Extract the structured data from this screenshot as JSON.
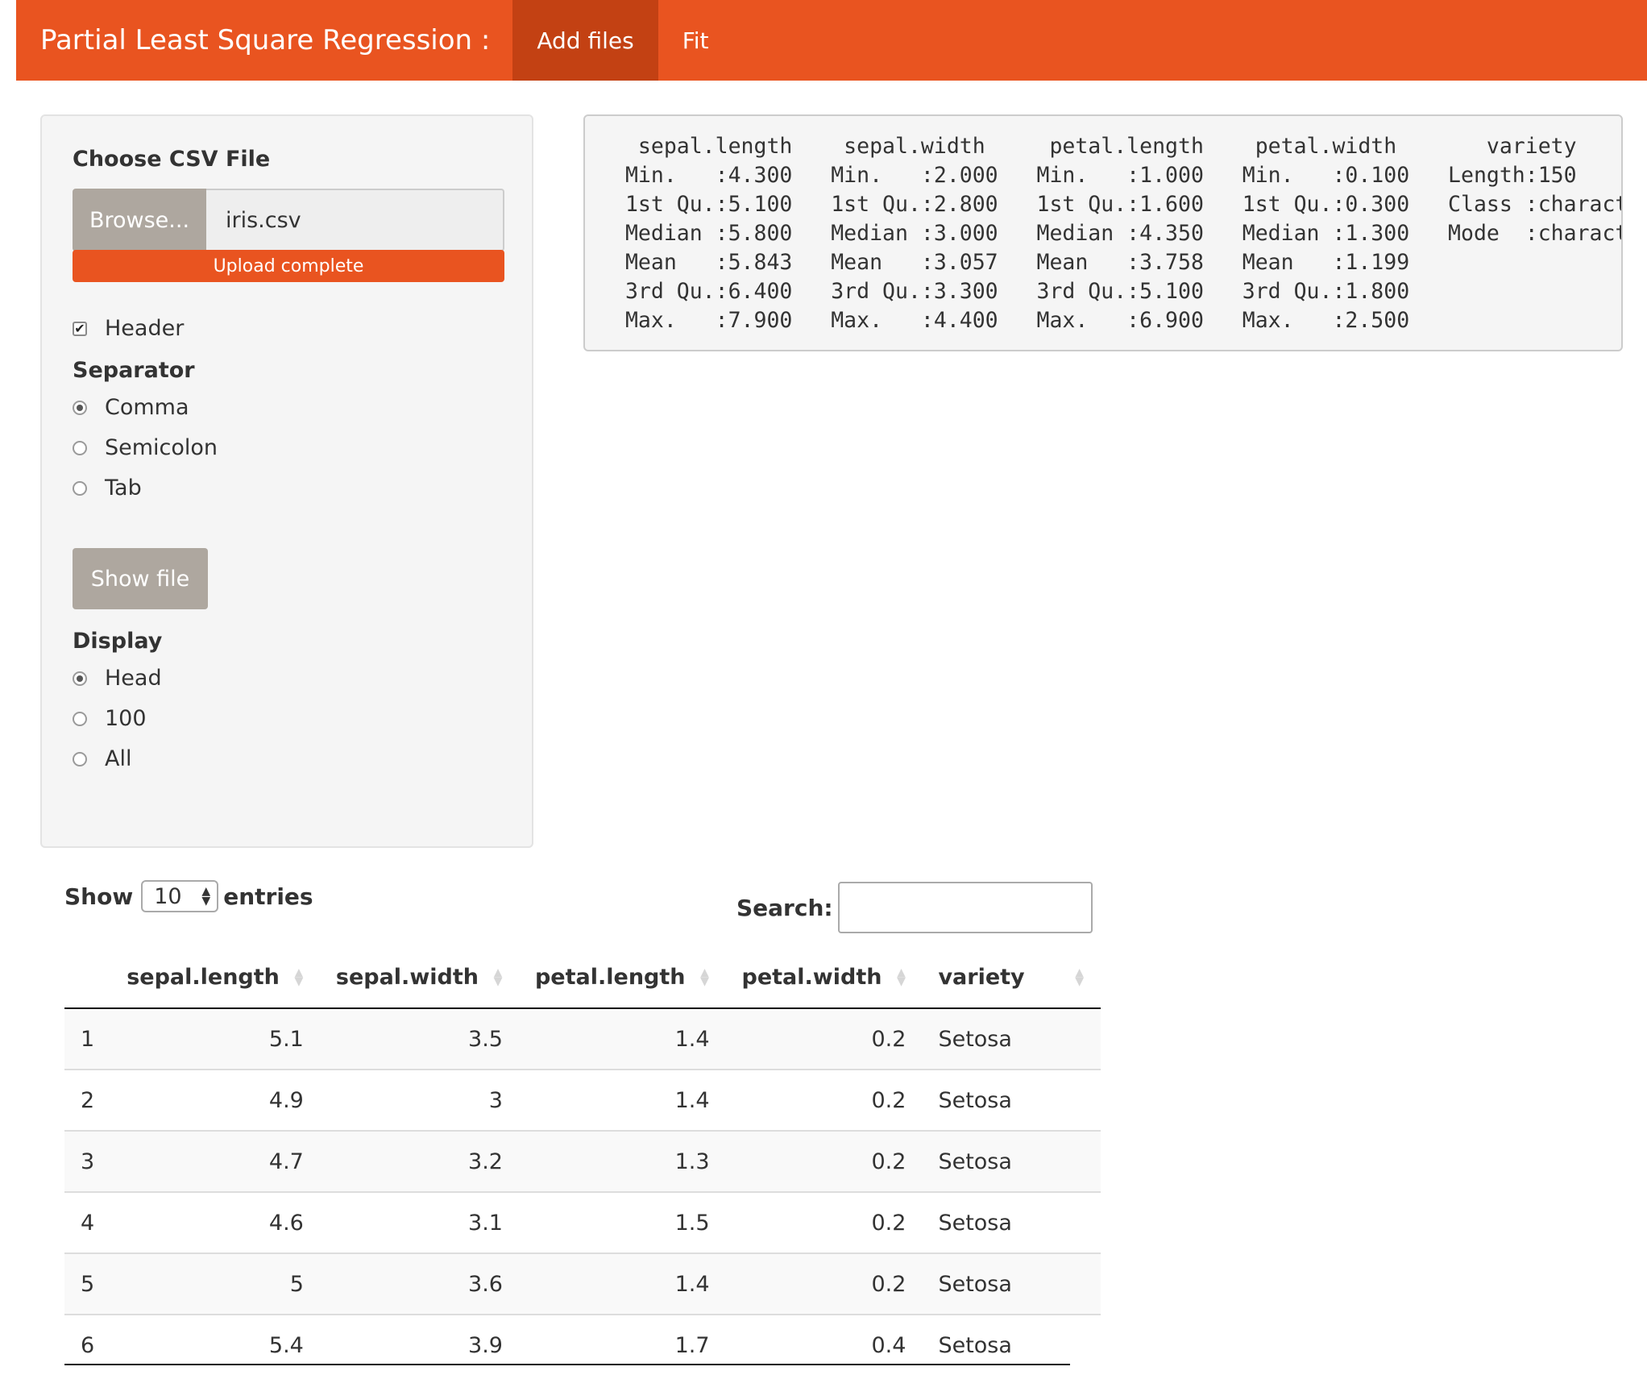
{
  "navbar": {
    "brand": "Partial Least Square Regression :",
    "tabs": [
      {
        "label": "Add files",
        "active": true
      },
      {
        "label": "Fit",
        "active": false
      }
    ]
  },
  "sidebar": {
    "file_label": "Choose CSV File",
    "browse_label": "Browse...",
    "file_name": "iris.csv",
    "upload_status": "Upload complete",
    "upload_progress": 1.0,
    "header_label": "Header",
    "header_checked": true,
    "separator_label": "Separator",
    "separator_options": [
      "Comma",
      "Semicolon",
      "Tab"
    ],
    "separator_selected": "Comma",
    "show_file_label": "Show file",
    "display_label": "Display",
    "display_options": [
      "Head",
      "100",
      "All"
    ],
    "display_selected": "Head"
  },
  "summary": {
    "text": "  sepal.length    sepal.width     petal.length    petal.width       variety        \n Min.   :4.300   Min.   :2.000   Min.   :1.000   Min.   :0.100   Length:150        \n 1st Qu.:5.100   1st Qu.:2.800   1st Qu.:1.600   1st Qu.:0.300   Class :character  \n Median :5.800   Median :3.000   Median :4.350   Median :1.300   Mode  :character  \n Mean   :5.843   Mean   :3.057   Mean   :3.758   Mean   :1.199                     \n 3rd Qu.:6.400   3rd Qu.:3.300   3rd Qu.:5.100   3rd Qu.:1.800                     \n Max.   :7.900   Max.   :4.400   Max.   :6.900   Max.   :2.500                     "
  },
  "datatable": {
    "show_label": "Show",
    "entries_value": "10",
    "entries_label": "entries",
    "search_label": "Search:",
    "search_value": "",
    "columns": [
      "",
      "sepal.length",
      "sepal.width",
      "petal.length",
      "petal.width",
      "variety"
    ],
    "rows": [
      [
        "1",
        "5.1",
        "3.5",
        "1.4",
        "0.2",
        "Setosa"
      ],
      [
        "2",
        "4.9",
        "3",
        "1.4",
        "0.2",
        "Setosa"
      ],
      [
        "3",
        "4.7",
        "3.2",
        "1.3",
        "0.2",
        "Setosa"
      ],
      [
        "4",
        "4.6",
        "3.1",
        "1.5",
        "0.2",
        "Setosa"
      ],
      [
        "5",
        "5",
        "3.6",
        "1.4",
        "0.2",
        "Setosa"
      ],
      [
        "6",
        "5.4",
        "3.9",
        "1.7",
        "0.4",
        "Setosa"
      ]
    ]
  },
  "colors": {
    "brand": "#e95420",
    "brand_active": "#c34113",
    "button_gray": "#aea79f"
  }
}
